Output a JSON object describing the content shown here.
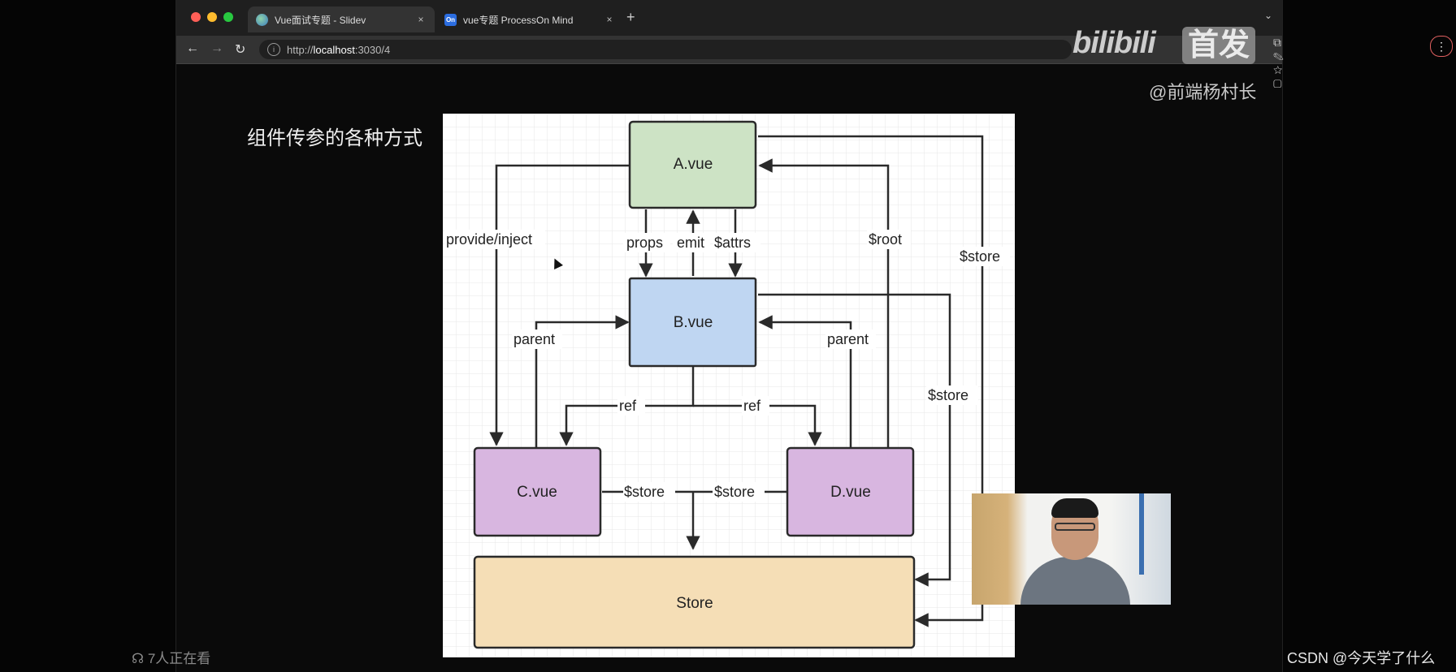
{
  "browser": {
    "tabs": [
      {
        "label": "Vue面试专题 - Slidev",
        "icon": "globe-icon",
        "active": true
      },
      {
        "label": "vue专题 ProcessOn Mind",
        "icon": "processon-icon",
        "active": false
      }
    ],
    "favicon_on": "On",
    "close_glyph": "×",
    "new_tab": "+",
    "tab_menu": "⌄",
    "url_scheme": "http://",
    "url_host": "localhost",
    "url_path": ":3030/4",
    "info_glyph": "i"
  },
  "watermark": {
    "logo": "bilibili",
    "badge": "首发",
    "uploader": "@前端杨村长"
  },
  "slide": {
    "title": "组件传参的各种方式"
  },
  "diagram": {
    "nodes": {
      "a": "A.vue",
      "b": "B.vue",
      "c": "C.vue",
      "d": "D.vue",
      "store": "Store"
    },
    "labels": {
      "provide_inject": "provide/inject",
      "props": "props",
      "emit": "emit",
      "attrs": "$attrs",
      "root": "$root",
      "store_outer": "$store",
      "store_b": "$store",
      "parent_left": "parent",
      "parent_right": "parent",
      "ref_left": "ref",
      "ref_right": "ref",
      "store_c": "$store",
      "store_d": "$store"
    },
    "colors": {
      "a": "#cde3c5",
      "b": "#bfd6f2",
      "cd": "#d8b6e0",
      "store": "#f5deb6"
    }
  },
  "footer": {
    "viewers": "7人正在看",
    "credit": "CSDN @今天学了什么"
  }
}
